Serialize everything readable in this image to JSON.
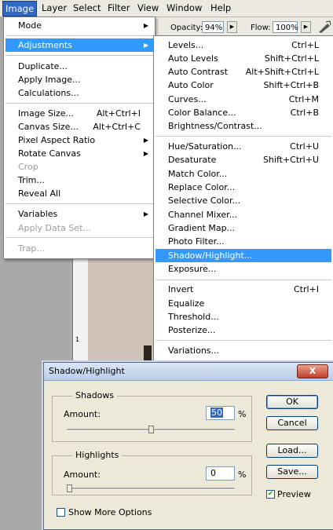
{
  "menubar": [
    "Image",
    "Layer",
    "Select",
    "Filter",
    "View",
    "Window",
    "Help"
  ],
  "options": {
    "opacity_label": "Opacity:",
    "opacity_value": "94%",
    "flow_label": "Flow:",
    "flow_value": "100%"
  },
  "ruler_mark": "1",
  "image_menu": [
    {
      "label": "Mode",
      "arrow": "▶"
    },
    {
      "label": "Adjustments",
      "arrow": "▶"
    },
    {
      "label": "Duplicate..."
    },
    {
      "label": "Apply Image..."
    },
    {
      "label": "Calculations..."
    },
    {
      "label": "Image Size...",
      "shortcut": "Alt+Ctrl+I"
    },
    {
      "label": "Canvas Size...",
      "shortcut": "Alt+Ctrl+C"
    },
    {
      "label": "Pixel Aspect Ratio",
      "arrow": "▶"
    },
    {
      "label": "Rotate Canvas",
      "arrow": "▶"
    },
    {
      "label": "Crop"
    },
    {
      "label": "Trim..."
    },
    {
      "label": "Reveal All"
    },
    {
      "label": "Variables",
      "arrow": "▶"
    },
    {
      "label": "Apply Data Set..."
    },
    {
      "label": "Trap..."
    }
  ],
  "adjustments_menu": [
    {
      "label": "Levels...",
      "shortcut": "Ctrl+L"
    },
    {
      "label": "Auto Levels",
      "shortcut": "Shift+Ctrl+L"
    },
    {
      "label": "Auto Contrast",
      "shortcut": "Alt+Shift+Ctrl+L"
    },
    {
      "label": "Auto Color",
      "shortcut": "Shift+Ctrl+B"
    },
    {
      "label": "Curves...",
      "shortcut": "Ctrl+M"
    },
    {
      "label": "Color Balance...",
      "shortcut": "Ctrl+B"
    },
    {
      "label": "Brightness/Contrast..."
    },
    {
      "label": "Hue/Saturation...",
      "shortcut": "Ctrl+U"
    },
    {
      "label": "Desaturate",
      "shortcut": "Shift+Ctrl+U"
    },
    {
      "label": "Match Color..."
    },
    {
      "label": "Replace Color..."
    },
    {
      "label": "Selective Color..."
    },
    {
      "label": "Channel Mixer..."
    },
    {
      "label": "Gradient Map..."
    },
    {
      "label": "Photo Filter..."
    },
    {
      "label": "Shadow/Highlight..."
    },
    {
      "label": "Exposure..."
    },
    {
      "label": "Invert",
      "shortcut": "Ctrl+I"
    },
    {
      "label": "Equalize"
    },
    {
      "label": "Threshold..."
    },
    {
      "label": "Posterize..."
    },
    {
      "label": "Variations..."
    }
  ],
  "dialog": {
    "title": "Shadow/Highlight",
    "close": "X",
    "shadows": {
      "title": "Shadows",
      "amount_label": "Amount:",
      "amount_value": "50",
      "percent": "%",
      "level": 0.5
    },
    "highlights": {
      "title": "Highlights",
      "amount_label": "Amount:",
      "amount_value": "0",
      "percent": "%",
      "level": 0.0
    },
    "ok": "OK",
    "cancel": "Cancel",
    "load": "Load...",
    "save": "Save...",
    "preview_label": "Preview",
    "preview_checked": true,
    "more_options_label": "Show More Options",
    "more_options_checked": false
  }
}
